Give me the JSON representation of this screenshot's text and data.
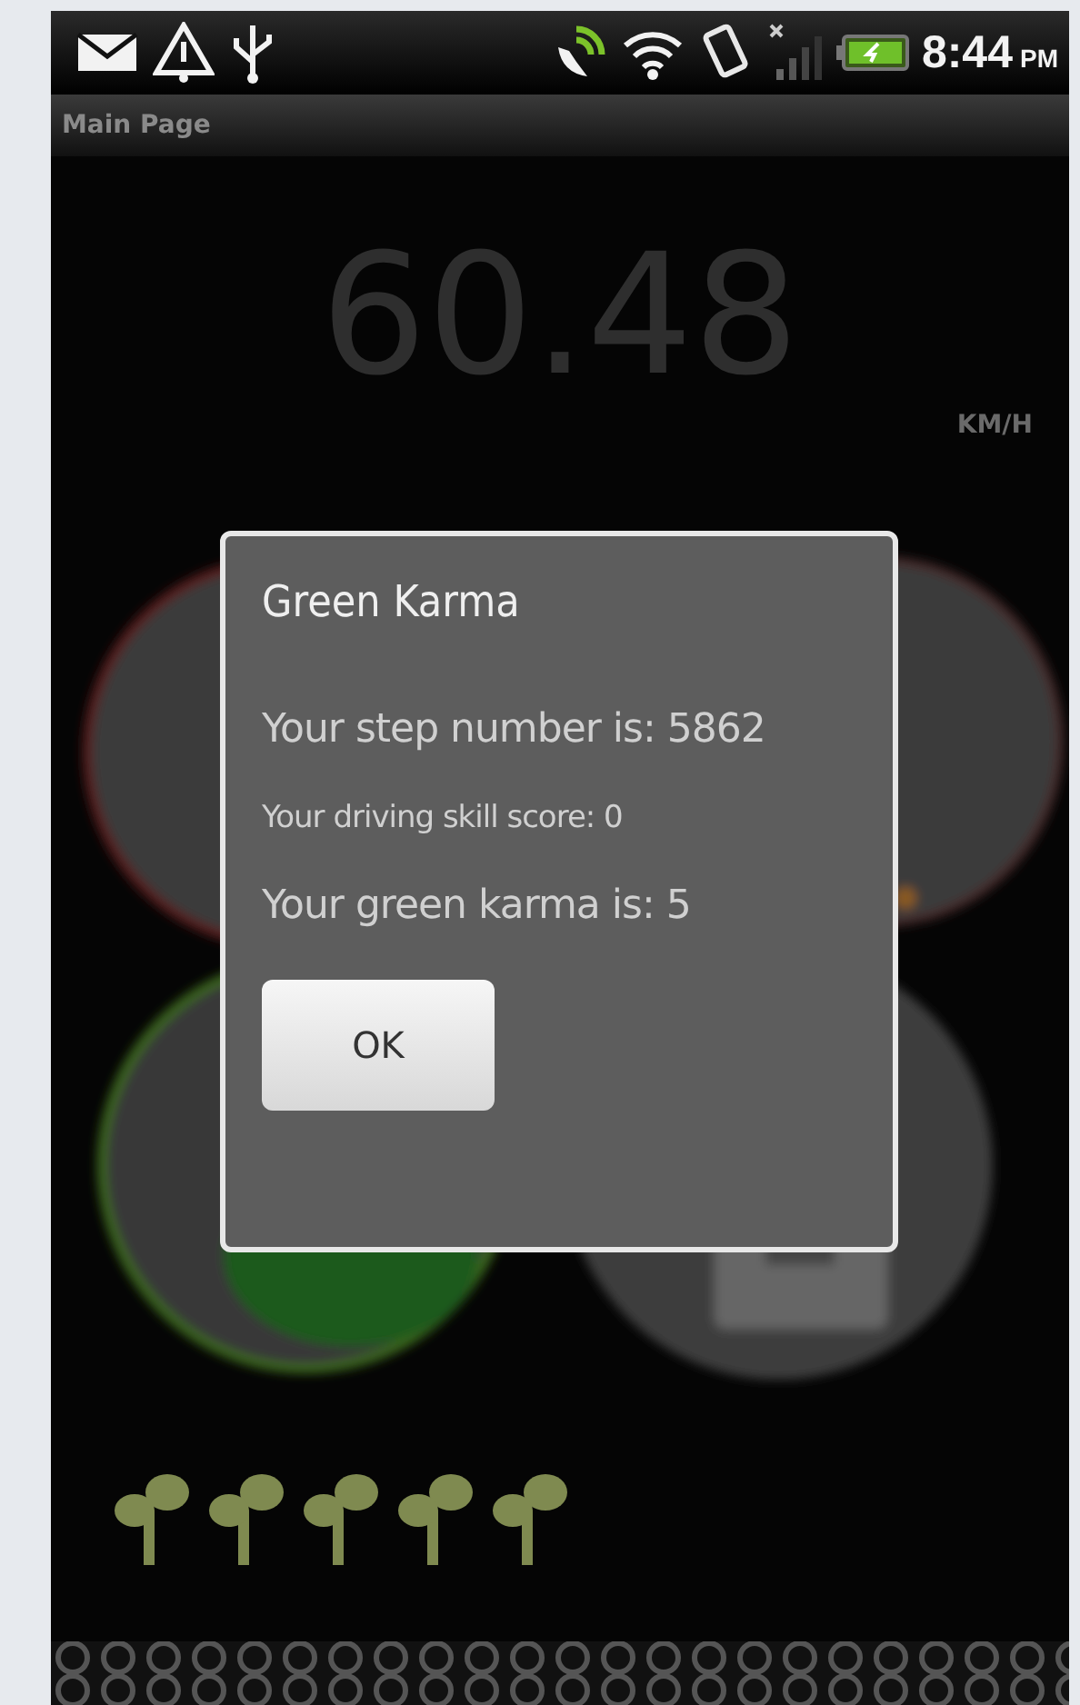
{
  "status_bar": {
    "time": "8:44",
    "meridiem": "PM"
  },
  "title_bar": {
    "title": "Main Page"
  },
  "speedometer": {
    "speed": "60.48",
    "unit": "KM/H"
  },
  "dialog": {
    "title": "Green Karma",
    "lines": [
      {
        "text": "Your step number is: 5862",
        "kind": "large"
      },
      {
        "text": "Your driving skill score: 0",
        "kind": "small"
      },
      {
        "text": "Your green karma is: 5",
        "kind": "large"
      }
    ],
    "buttons": [
      "OK"
    ]
  }
}
